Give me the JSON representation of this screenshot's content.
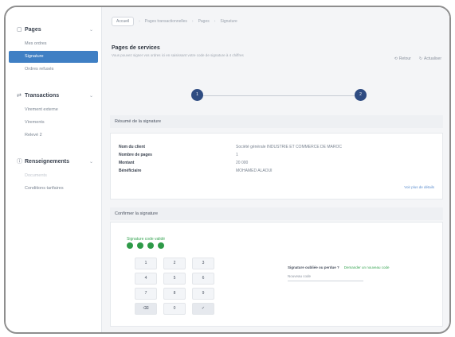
{
  "sidebar": {
    "sections": [
      {
        "icon": "page-icon",
        "label": "Pages",
        "items": [
          {
            "label": "Mes ordres",
            "active": false
          },
          {
            "label": "Signature",
            "active": true
          },
          {
            "label": "Ordres refusés",
            "active": false
          }
        ]
      },
      {
        "icon": "transfer-icon",
        "label": "Transactions",
        "items": [
          {
            "label": "Virement externe",
            "active": false
          },
          {
            "label": "Virements",
            "active": false
          },
          {
            "label": "Relevé 2",
            "active": false
          }
        ]
      },
      {
        "icon": "info-icon",
        "label": "Renseignements",
        "items": [
          {
            "label": "Documents",
            "active": false,
            "disabled": true
          },
          {
            "label": "Conditions tarifaires",
            "active": false
          }
        ]
      }
    ]
  },
  "breadcrumb": {
    "home": "Accueil",
    "items": [
      "Pages transactionnelles",
      "Pages",
      "Signature"
    ]
  },
  "header": {
    "title": "Pages de services",
    "subtitle": "Vous pouvez signer vos ordres ici en saisissant votre code de signature à 4 chiffres",
    "action_back": "Retour",
    "action_refresh": "Actualiser"
  },
  "stepper": {
    "steps": [
      "1",
      "2"
    ]
  },
  "summary": {
    "title": "Résumé de la signature",
    "rows": [
      {
        "label": "Nom du client",
        "value": "Société générale INDUSTRIE ET COMMERCE DE MAROC"
      },
      {
        "label": "Nombre de pages",
        "value": "1"
      },
      {
        "label": "Montant",
        "value": "20 000"
      },
      {
        "label": "Bénéficiaire",
        "value": "MOHAMED ALAOUI"
      }
    ],
    "more_link": "Voir plus de détails"
  },
  "signature": {
    "title": "Confirmer la signature",
    "code_label": "Signature code validé",
    "dots": 4,
    "keys": [
      "1",
      "2",
      "3",
      "4",
      "5",
      "6",
      "7",
      "8",
      "9",
      "⌫",
      "0",
      "✓"
    ],
    "lost_question": "Signature oubliée ou perdue ?",
    "lost_link": "Demander un nouveau code",
    "field_label": "Nouveau code"
  }
}
